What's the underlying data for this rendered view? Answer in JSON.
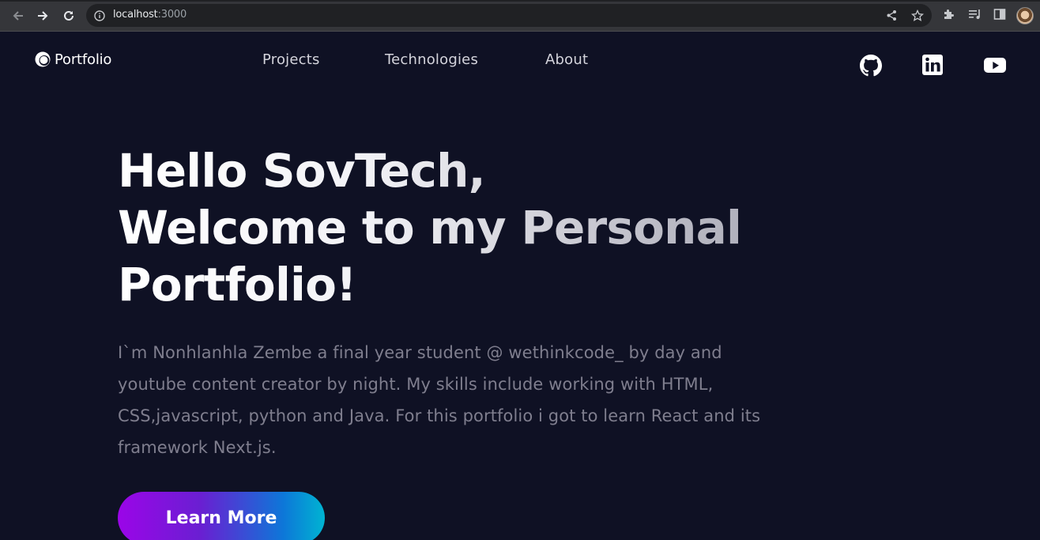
{
  "browser": {
    "url_host": "localhost",
    "url_port": ":3000"
  },
  "site": {
    "logo": {
      "text": "Portfolio",
      "icon": "circle-logo-icon"
    },
    "nav": [
      {
        "label": "Projects"
      },
      {
        "label": "Technologies"
      },
      {
        "label": "About"
      }
    ],
    "social": [
      {
        "icon": "github-icon"
      },
      {
        "icon": "linkedin-icon"
      },
      {
        "icon": "youtube-icon"
      }
    ],
    "hero": {
      "title_line1": "Hello SovTech,",
      "title_line2": "Welcome to my Personal",
      "title_line3": "Portfolio!",
      "description": "I`m Nonhlanhla Zembe a final year student @ wethinkcode_ by day and youtube content creator by night. My skills include working with HTML, CSS,javascript, python and Java. For this portfolio i got to learn React and its framework Next.js.",
      "cta_label": "Learn More"
    }
  },
  "colors": {
    "background": "#0f1124",
    "cta_gradient_start": "#9b05e8",
    "cta_gradient_end": "#00b4d2",
    "muted_text": "#7f7e8e"
  }
}
